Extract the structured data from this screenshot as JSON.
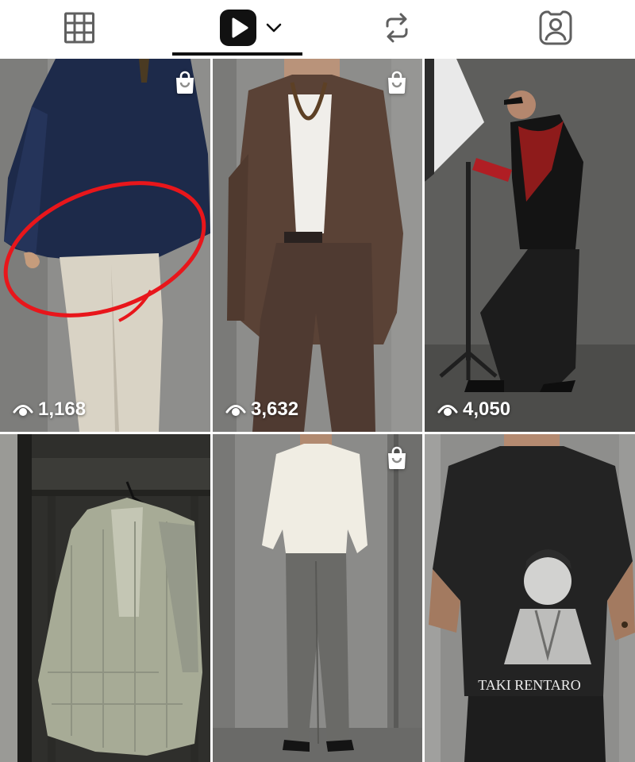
{
  "tabs": [
    {
      "id": "grid",
      "icon": "grid-icon"
    },
    {
      "id": "reels",
      "icon": "play-icon",
      "dropdown_icon": "chevron-down-icon",
      "selected": true
    },
    {
      "id": "reposts",
      "icon": "repost-icon"
    },
    {
      "id": "tagged",
      "icon": "person-tag-icon"
    }
  ],
  "colors": {
    "accent": "#111111",
    "icon": "#5f5f5f",
    "overlay_text": "#ffffff",
    "annotation": "#e8161b"
  },
  "posts": [
    {
      "views": "1,168",
      "shopping": true
    },
    {
      "views": "3,632",
      "shopping": true
    },
    {
      "views": "4,050",
      "shopping": false
    },
    {
      "views": "",
      "shopping": false
    },
    {
      "views": "",
      "shopping": true
    },
    {
      "views": "",
      "shopping": false
    }
  ],
  "tile6_shirt_print": "TAKI RENTARO"
}
